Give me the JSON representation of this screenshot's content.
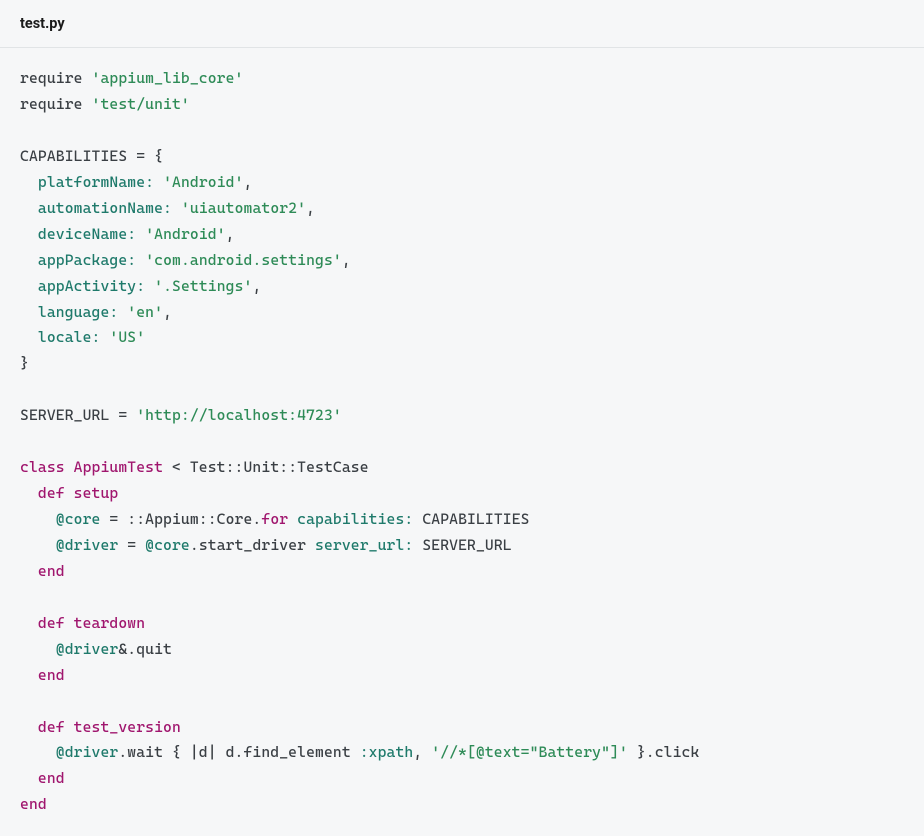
{
  "filename": "test.py",
  "code": {
    "l01_kw": "require",
    "l01_str": "'appium_lib_core'",
    "l02_kw": "require",
    "l02_str": "'test/unit'",
    "l04_name": "CAPABILITIES",
    "l04_eq": " = {",
    "l05_key": "platformName:",
    "l05_val": "'Android'",
    "l05_c": ",",
    "l06_key": "automationName:",
    "l06_val": "'uiautomator2'",
    "l06_c": ",",
    "l07_key": "deviceName:",
    "l07_val": "'Android'",
    "l07_c": ",",
    "l08_key": "appPackage:",
    "l08_val": "'com.android.settings'",
    "l08_c": ",",
    "l09_key": "appActivity:",
    "l09_val": "'.Settings'",
    "l09_c": ",",
    "l10_key": "language:",
    "l10_val": "'en'",
    "l10_c": ",",
    "l11_key": "locale:",
    "l11_val": "'US'",
    "l12_close": "}",
    "l14_name": "SERVER_URL",
    "l14_eq": " = ",
    "l14_val": "'http://localhost:4723'",
    "l16_kw": "class",
    "l16_cls": "AppiumTest",
    "l16_rest": " < Test::Unit::TestCase",
    "l17_kw": "def",
    "l17_fn": "setup",
    "l18_v1": "@core",
    "l18_eq1": " = ::Appium::Core.",
    "l18_fn": "for",
    "l18_sp": " ",
    "l18_sym": "capabilities:",
    "l18_sp2": " ",
    "l18_const": "CAPABILITIES",
    "l19_v1": "@driver",
    "l19_eq": " = ",
    "l19_v2": "@core",
    "l19_m": ".start_driver ",
    "l19_sym": "server_url:",
    "l19_sp": " ",
    "l19_const": "SERVER_URL",
    "l20_kw": "end",
    "l22_kw": "def",
    "l22_fn": "teardown",
    "l23_v": "@driver",
    "l23_m": "&.quit",
    "l24_kw": "end",
    "l26_kw": "def",
    "l26_fn": "test_version",
    "l27_v": "@driver",
    "l27_m1": ".wait { |d| d.find_element ",
    "l27_sym": ":xpath",
    "l27_c": ", ",
    "l27_str": "'//*[@text=\"Battery\"]'",
    "l27_m2": " }.click",
    "l28_kw": "end",
    "l29_kw": "end"
  }
}
